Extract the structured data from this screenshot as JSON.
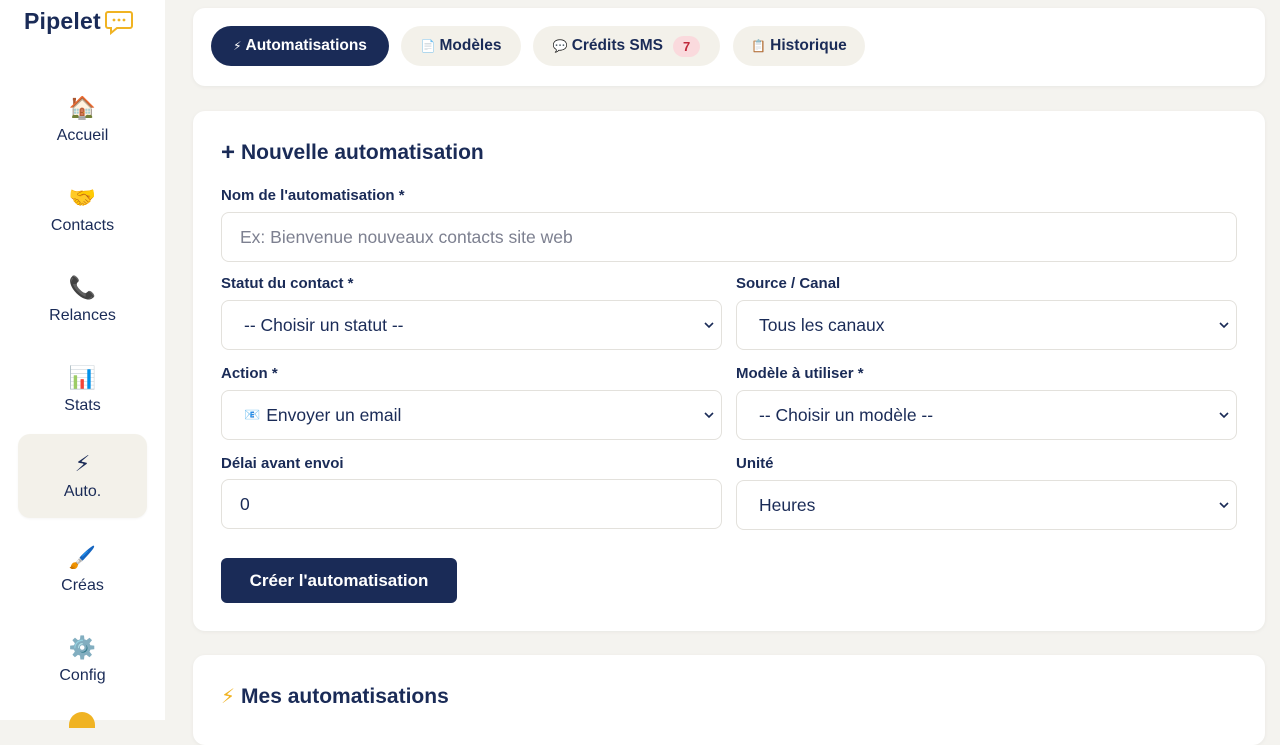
{
  "brand": {
    "name": "Pipelet",
    "icon": "speech-bubble-icon"
  },
  "sidebar": {
    "items": [
      {
        "label": "Accueil",
        "icon": "🏠",
        "icon_name": "house-icon",
        "active": false
      },
      {
        "label": "Contacts",
        "icon": "🤝",
        "icon_name": "handshake-icon",
        "active": false
      },
      {
        "label": "Relances",
        "icon": "📞",
        "icon_name": "phone-icon",
        "active": false
      },
      {
        "label": "Stats",
        "icon": "📊",
        "icon_name": "bar-chart-icon",
        "active": false
      },
      {
        "label": "Auto.",
        "icon": "⚡",
        "icon_name": "lightning-icon",
        "active": true
      },
      {
        "label": "Créas",
        "icon": "🖌️",
        "icon_name": "paintbrush-icon",
        "active": false
      },
      {
        "label": "Config",
        "icon": "⚙️",
        "icon_name": "gear-icon",
        "active": false
      }
    ]
  },
  "tabs": [
    {
      "label": "Automatisations",
      "icon": "⚡",
      "active": true
    },
    {
      "label": "Modèles",
      "icon": "📄",
      "active": false
    },
    {
      "label": "Crédits SMS",
      "icon": "💬",
      "badge": "7",
      "active": false
    },
    {
      "label": "Historique",
      "icon": "📋",
      "active": false
    }
  ],
  "form": {
    "title": "Nouvelle automatisation",
    "name_label": "Nom de l'automatisation *",
    "name_placeholder": "Ex: Bienvenue nouveaux contacts site web",
    "status_label": "Statut du contact *",
    "status_value": "-- Choisir un statut --",
    "source_label": "Source / Canal",
    "source_value": "Tous les canaux",
    "action_label": "Action *",
    "action_icon": "📧",
    "action_value": "Envoyer un email",
    "template_label": "Modèle à utiliser *",
    "template_value": "-- Choisir un modèle --",
    "delay_label": "Délai avant envoi",
    "delay_value": "0",
    "unit_label": "Unité",
    "unit_value": "Heures",
    "submit_label": "Créer l'automatisation"
  },
  "list": {
    "title": "Mes automatisations"
  },
  "colors": {
    "primary": "#1a2b57",
    "background": "#f4f3ef",
    "badge_bg": "#fadadd",
    "badge_text": "#c0283a"
  }
}
